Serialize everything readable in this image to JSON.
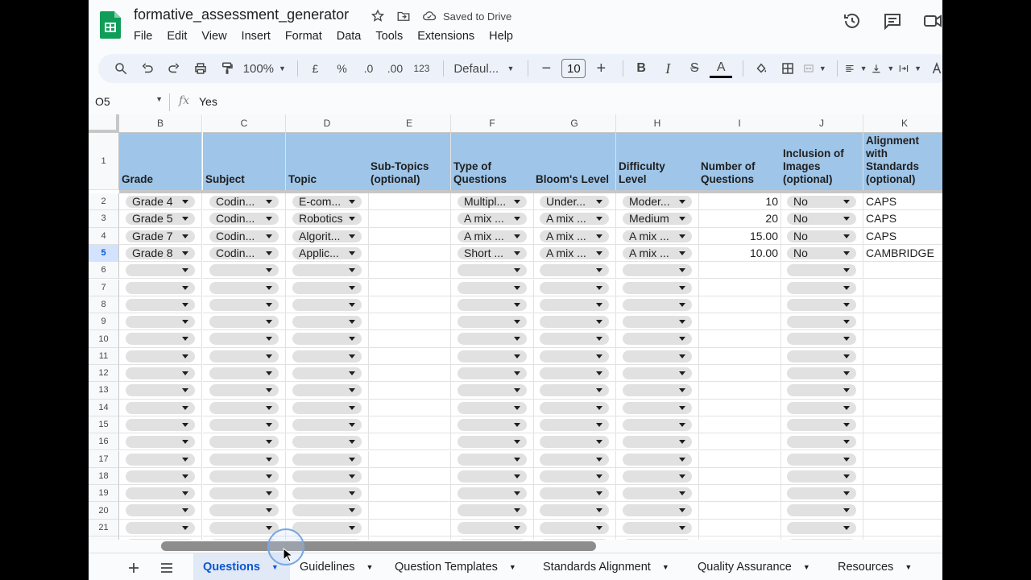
{
  "app": {
    "title": "formative_assessment_generator",
    "saved_status": "Saved to Drive",
    "menu": [
      "File",
      "Edit",
      "View",
      "Insert",
      "Format",
      "Data",
      "Tools",
      "Extensions",
      "Help"
    ]
  },
  "toolbar": {
    "zoom": "100%",
    "currency": "£",
    "percent": "%",
    "dec_decrease": ".0",
    "dec_increase": ".00",
    "number_format": "123",
    "font": "Defaul...",
    "font_size": "10",
    "minus": "−",
    "plus": "+",
    "bold": "B",
    "italic": "I",
    "strike": "S",
    "text_color": "A"
  },
  "formula_bar": {
    "cell_ref": "O5",
    "fx": "fx",
    "value": "Yes"
  },
  "grid": {
    "columns": [
      "B",
      "C",
      "D",
      "E",
      "F",
      "G",
      "H",
      "I",
      "J",
      "K"
    ],
    "header_row_number": "1",
    "headers": [
      "Grade",
      "Subject",
      "Topic",
      "Sub-Topics (optional)",
      "Type of Questions",
      "Bloom's Level",
      "Difficulty Level",
      "Number of Questions",
      "Inclusion of Images (optional)",
      "Alignment with Standards (optional)"
    ],
    "rows": [
      {
        "n": "2",
        "cells": [
          "Grade 4",
          "Codin...",
          "E-com...",
          "",
          "Multipl...",
          "Under...",
          "Moder...",
          "10",
          "No",
          "CAPS"
        ]
      },
      {
        "n": "3",
        "cells": [
          "Grade 5",
          "Codin...",
          "Robotics",
          "",
          "A mix ...",
          "A mix ...",
          "Medium",
          "20",
          "No",
          "CAPS"
        ]
      },
      {
        "n": "4",
        "cells": [
          "Grade 7",
          "Codin...",
          "Algorit...",
          "",
          "A mix ...",
          "A mix ...",
          "A mix ...",
          "15.00",
          "No",
          "CAPS"
        ]
      },
      {
        "n": "5",
        "cells": [
          "Grade 8",
          "Codin...",
          "Applic...",
          "",
          "Short ...",
          "A mix ...",
          "A mix ...",
          "10.00",
          "No",
          "CAMBRIDGE"
        ]
      }
    ],
    "empty_rows": [
      "6",
      "7",
      "8",
      "9",
      "10",
      "11",
      "12",
      "13",
      "14",
      "15",
      "16",
      "17",
      "18",
      "19",
      "20",
      "21"
    ],
    "selected_row": "5"
  },
  "sheets": {
    "tabs": [
      "Questions",
      "Guidelines",
      "Question Templates",
      "Standards Alignment",
      "Quality Assurance",
      "Resources"
    ],
    "active": "Questions"
  },
  "colors": {
    "header_fill": "#9fc5e8",
    "chip": "#e1e1e1",
    "accent": "#0b57d0"
  }
}
